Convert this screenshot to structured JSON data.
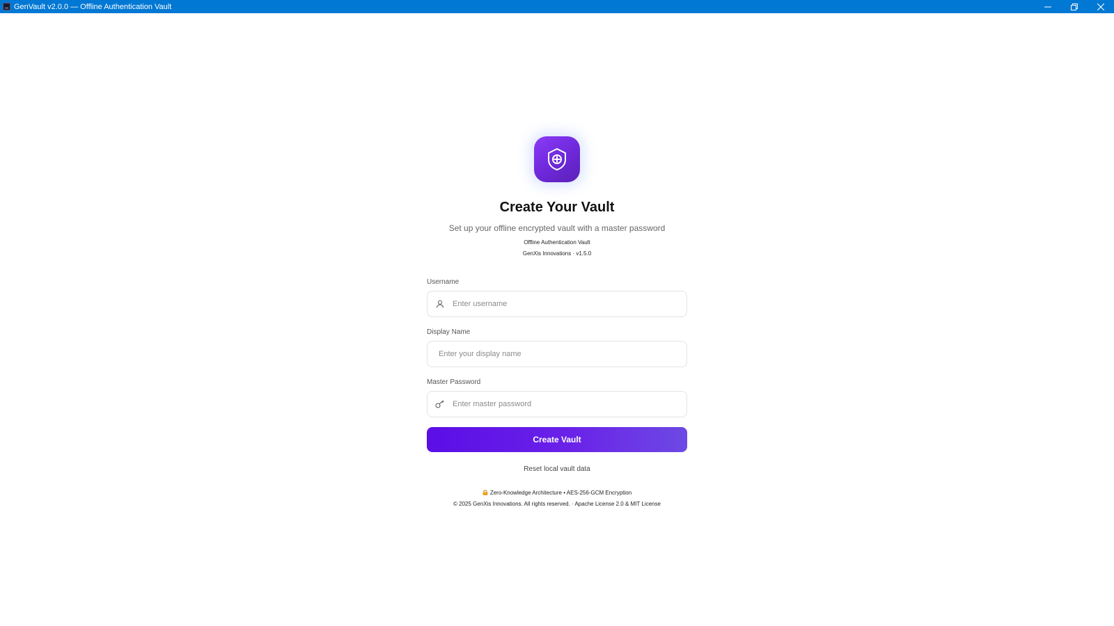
{
  "window": {
    "title": "GenVault v2.0.0 — Offline Authentication Vault",
    "controls": [
      "minimize-icon",
      "restore-icon",
      "close-icon"
    ]
  },
  "header": {
    "logo_icon": "shield-plus-icon",
    "title": "Create Your Vault",
    "subtitle": "Set up your offline encrypted vault with a master password",
    "tagline": "Offline Authentication Vault",
    "company_version": "GenXis Innovations · v1.5.0"
  },
  "form": {
    "username": {
      "label": "Username",
      "placeholder": "Enter username",
      "icon": "user-icon",
      "value": ""
    },
    "display_name": {
      "label": "Display Name",
      "placeholder": "Enter your display name",
      "value": ""
    },
    "master_password": {
      "label": "Master Password",
      "placeholder": "Enter master password",
      "icon": "key-icon",
      "value": ""
    },
    "submit_label": "Create Vault",
    "reset_label": "Reset local vault data"
  },
  "footer": {
    "security_icon": "lock-icon",
    "security_text": "Zero-Knowledge Architecture • AES-256-GCM Encryption",
    "copyright": "© 2025 GenXis Innovations. All rights reserved. · Apache License 2.0 & MIT License"
  },
  "colors": {
    "titlebar": "#0078d4",
    "accent": "#5b0ee6",
    "logo_gradient_start": "#8b3cf7",
    "logo_gradient_end": "#5b21b6"
  }
}
